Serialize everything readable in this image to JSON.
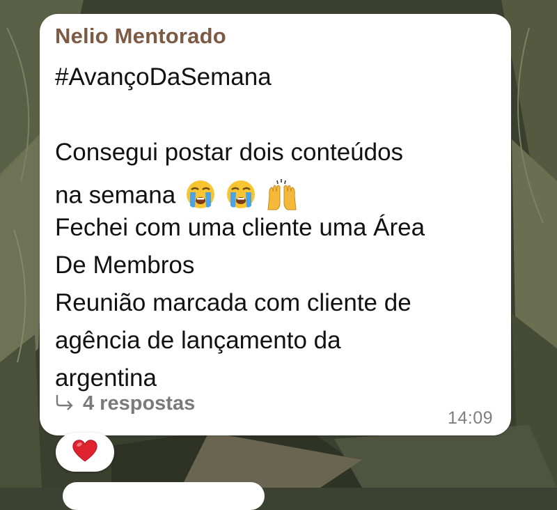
{
  "message": {
    "sender": "Nelio Mentorado",
    "lines": [
      "#AvançoDaSemana",
      "",
      "Consegui postar dois conteúdos",
      "na semana",
      "Fechei com uma cliente uma Área",
      "De Membros",
      "Reunião marcada com cliente de",
      "agência de lançamento da",
      "argentina"
    ],
    "emojis": [
      "loudly-crying-face",
      "loudly-crying-face",
      "raising-hands"
    ],
    "replies_label": "4 respostas",
    "time": "14:09"
  },
  "reaction": {
    "emoji": "red-heart"
  },
  "colors": {
    "sender": "#7d5a44",
    "bubble": "#ffffff",
    "wallpaper": "#3c4231",
    "muted": "#7a7a7a"
  }
}
